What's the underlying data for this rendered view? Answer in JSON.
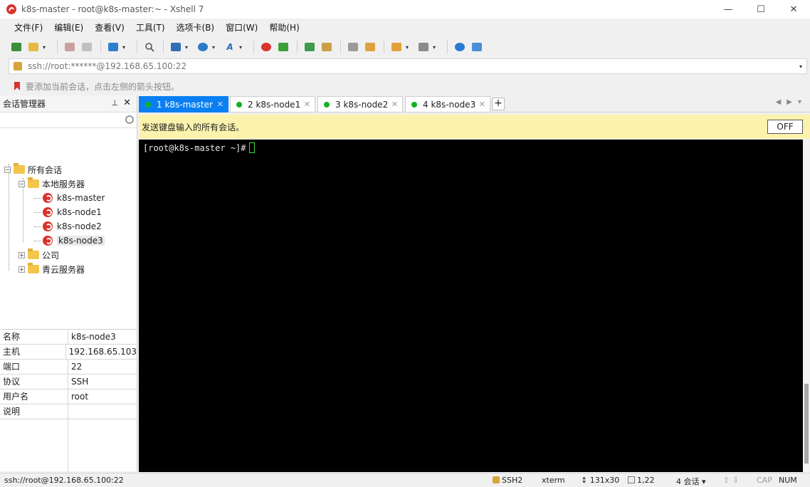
{
  "window": {
    "title": "k8s-master - root@k8s-master:~ - Xshell 7",
    "minimize_glyph": "—",
    "maximize_glyph": "☐",
    "close_glyph": "✕"
  },
  "menu": [
    "文件(F)",
    "编辑(E)",
    "查看(V)",
    "工具(T)",
    "选项卡(B)",
    "窗口(W)",
    "帮助(H)"
  ],
  "address": {
    "value": "ssh://root:******@192.168.65.100:22"
  },
  "hint": {
    "text": "要添加当前会话，点击左侧的箭头按钮。"
  },
  "session_manager": {
    "title": "会话管理器",
    "tree": {
      "root": "所有会话",
      "local": "本地服务器",
      "sessions": [
        "k8s-master",
        "k8s-node1",
        "k8s-node2",
        "k8s-node3"
      ],
      "company": "公司",
      "qingcloud": "青云服务器"
    },
    "properties": [
      {
        "key": "名称",
        "value": "k8s-node3"
      },
      {
        "key": "主机",
        "value": "192.168.65.103"
      },
      {
        "key": "端口",
        "value": "22"
      },
      {
        "key": "协议",
        "value": "SSH"
      },
      {
        "key": "用户名",
        "value": "root"
      },
      {
        "key": "说明",
        "value": ""
      }
    ]
  },
  "tabs": [
    {
      "label": "1 k8s-master",
      "active": true
    },
    {
      "label": "2 k8s-node1",
      "active": false
    },
    {
      "label": "3 k8s-node2",
      "active": false
    },
    {
      "label": "4 k8s-node3",
      "active": false
    }
  ],
  "send_bar": {
    "text": "发送键盘输入的所有会话。",
    "button": "OFF"
  },
  "terminal": {
    "prompt": "[root@k8s-master ~]#"
  },
  "status": {
    "connection": "ssh://root@192.168.65.100:22",
    "protocol": "SSH2",
    "terminal_type": "xterm",
    "size": "131x30",
    "cursor_pos": "1,22",
    "sessions": "4 会话",
    "cap": "CAP",
    "num": "NUM"
  },
  "colors": {
    "tab_active": "#0a7ff2",
    "status_dot": "#12b022",
    "send_bar": "#fbf3ad",
    "xshell_red": "#d8342c"
  }
}
